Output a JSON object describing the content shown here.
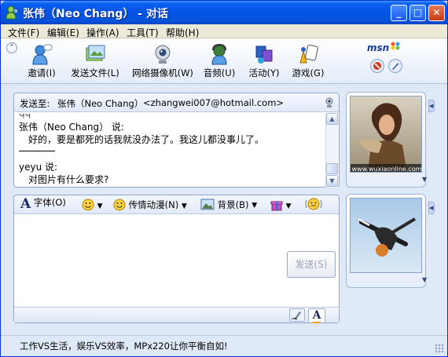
{
  "window": {
    "title": "张伟（Neo Chang） - 对话",
    "colors": {
      "titlebar": "#0553e3",
      "frame": "#dfe8f7",
      "accent": "#1a3a99"
    }
  },
  "menubar": {
    "items": [
      {
        "label": "文件(F)"
      },
      {
        "label": "编辑(E)"
      },
      {
        "label": "操作(A)"
      },
      {
        "label": "工具(T)"
      },
      {
        "label": "帮助(H)"
      }
    ]
  },
  "toolbar": {
    "items": [
      {
        "label": "邀请(I)",
        "icon": "invite-icon"
      },
      {
        "label": "发送文件(L)",
        "icon": "send-file-icon"
      },
      {
        "label": "网络摄像机(W)",
        "icon": "webcam-icon"
      },
      {
        "label": "音频(U)",
        "icon": "audio-icon"
      },
      {
        "label": "活动(Y)",
        "icon": "activities-icon"
      },
      {
        "label": "游戏(G)",
        "icon": "games-icon"
      }
    ],
    "logo": "msn"
  },
  "conversation": {
    "to_label": "发送至:",
    "to_name": "张伟（Neo Chang）",
    "to_email": "<zhangwei007@hotmail.com>",
    "messages": [
      {
        "sender": "张伟（Neo Chang） 说:",
        "text": "好的，要是都死的话我就没办法了。我这儿都没事儿了。"
      },
      {
        "sender": "yeyu 说:",
        "text": "对图片有什么要求?"
      }
    ],
    "partial_top": "qq"
  },
  "compose": {
    "font_label": "字体(O)",
    "wink_label": "传情动漫(N)",
    "background_label": "背景(B)",
    "send_label": "发送(S)",
    "input_value": ""
  },
  "avatars": {
    "contact_caption": "www.wuxiaonline.com",
    "self_caption": ""
  },
  "statusbar": {
    "ad_text": "工作VS生活，娱乐VS效率，MPx220让你平衡自如!"
  }
}
